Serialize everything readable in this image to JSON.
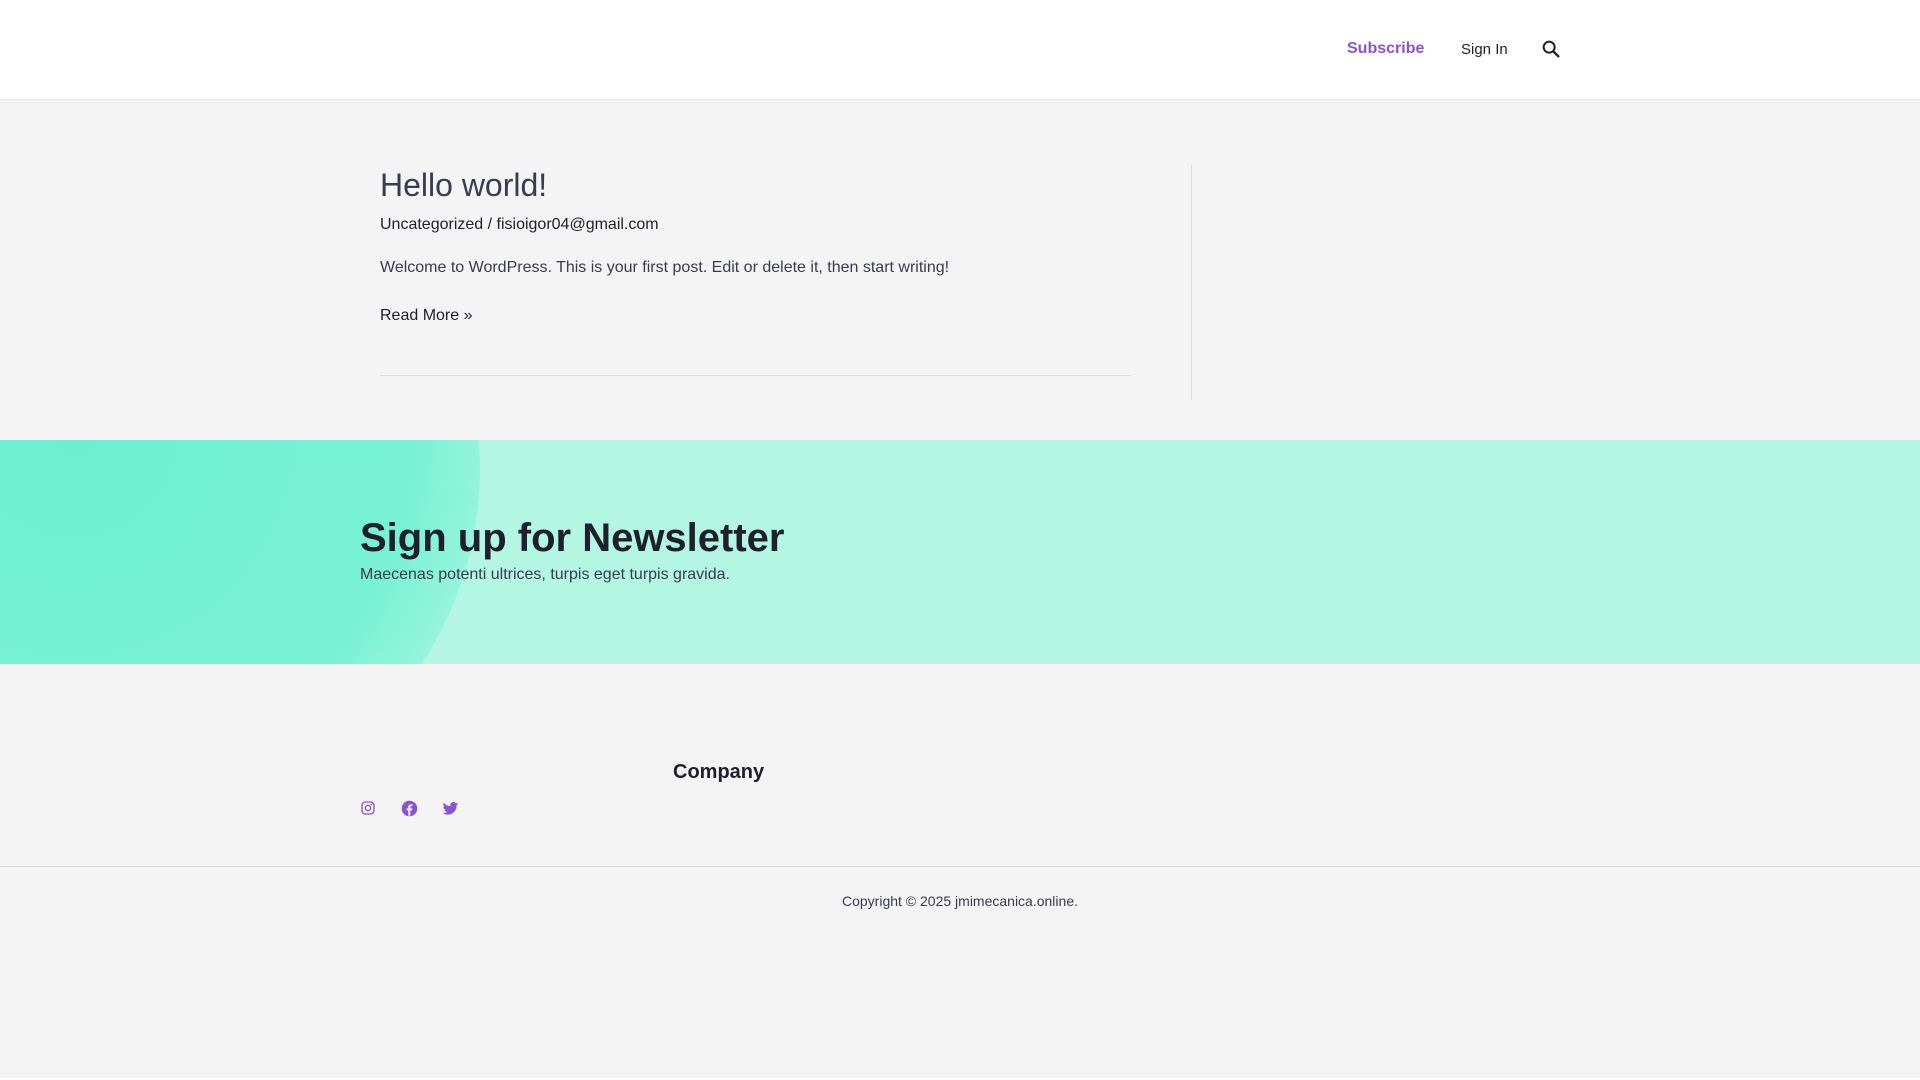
{
  "header": {
    "nav": {
      "subscribe_label": "Subscribe",
      "signin_label": "Sign In",
      "search_icon": "search-icon"
    }
  },
  "post": {
    "title": "Hello world!",
    "category": "Uncategorized",
    "separator": " / ",
    "author": "fisioigor04@gmail.com",
    "excerpt": "Welcome to WordPress. This is your first post. Edit or delete it, then start writing!",
    "read_more": "Read More »"
  },
  "newsletter": {
    "title": "Sign up for Newsletter",
    "subtitle": "Maecenas potenti ultrices, turpis eget turpis gravida."
  },
  "footer": {
    "company_heading": "Company",
    "social": [
      "instagram-icon",
      "facebook-icon",
      "twitter-icon"
    ],
    "copyright_prefix": "Copyright © 2025 ",
    "copyright_site": "jmimecanica.online",
    "copyright_suffix": "."
  },
  "colors": {
    "accent": "#8a52d6",
    "newsletter_bg": "#b3f7e3",
    "newsletter_blob": "#6ef0cf",
    "page_bg": "#f4f4f4",
    "text": "#3a3a52"
  }
}
